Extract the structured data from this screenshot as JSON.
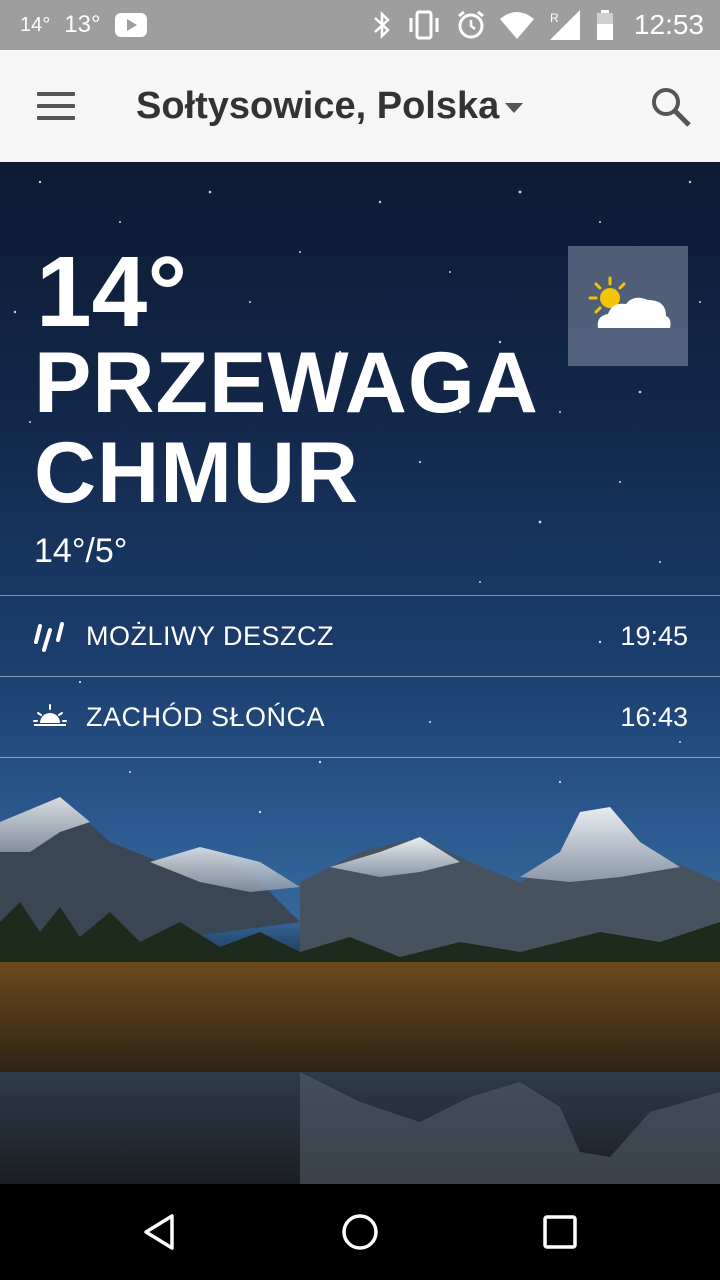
{
  "status_bar": {
    "temp_notification": "14°",
    "temp_small": "13°",
    "time": "12:53",
    "icons": [
      "youtube-icon",
      "bluetooth-icon",
      "vibrate-icon",
      "alarm-icon",
      "wifi-icon",
      "signal-icon",
      "battery-icon"
    ]
  },
  "app_bar": {
    "location": "Sołtysowice, Polska",
    "icons": [
      "menu-icon",
      "dropdown-icon",
      "search-icon"
    ]
  },
  "current": {
    "temperature": "14°",
    "condition_line1": "PRZEWAGA",
    "condition_line2": "CHMUR",
    "hi_lo": "14°/5°",
    "condition_icon": "partly-cloudy-icon"
  },
  "details": [
    {
      "icon": "rain-icon",
      "label": "MOŻLIWY DESZCZ",
      "value": "19:45"
    },
    {
      "icon": "sunset-icon",
      "label": "ZACHÓD SŁOŃCA",
      "value": "16:43"
    }
  ],
  "colors": {
    "status_bar": "#9e9e9e",
    "app_bar": "#f6f6f6",
    "title_text": "#333333",
    "hero_text": "#ffffff",
    "sun": "#f5c400"
  },
  "nav_bar": {
    "icons": [
      "back-icon",
      "home-icon",
      "recents-icon"
    ]
  }
}
